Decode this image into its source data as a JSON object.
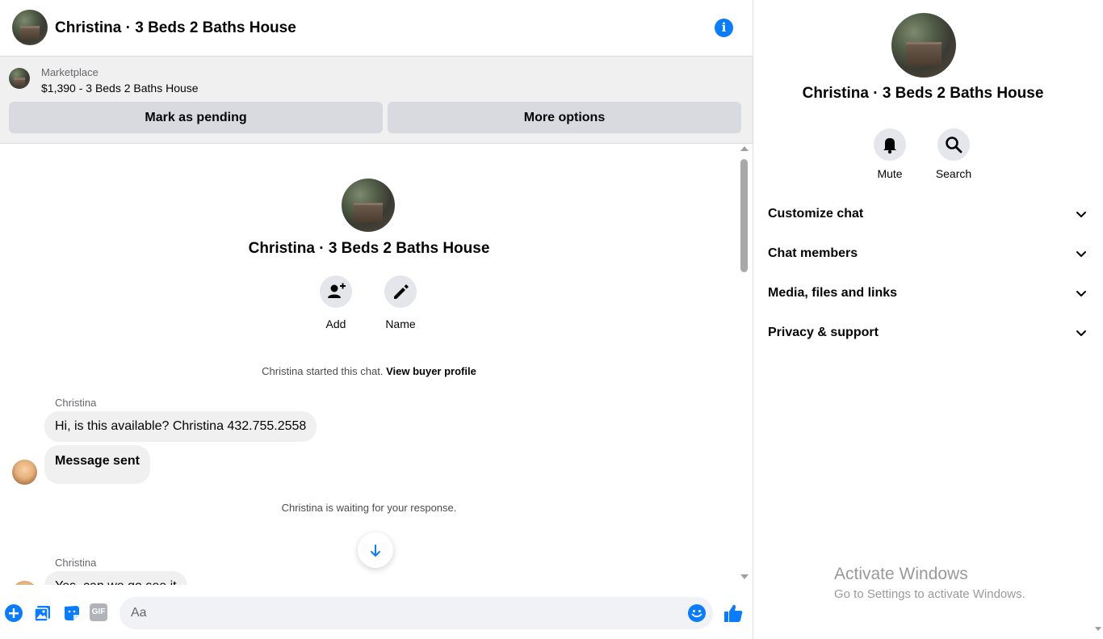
{
  "header": {
    "title": "Christina · 3 Beds 2 Baths House"
  },
  "marketplace": {
    "label": "Marketplace",
    "item": "$1,390 - 3 Beds 2 Baths House",
    "mark_pending_label": "Mark as pending",
    "more_options_label": "More options"
  },
  "conversation": {
    "title": "Christina · 3 Beds 2 Baths House",
    "add_label": "Add",
    "name_label": "Name",
    "started_note": "Christina started this chat.",
    "view_profile_link": "View buyer profile",
    "waiting_note": "Christina is waiting for your response.",
    "messages": [
      {
        "sender": "Christina",
        "text": "Hi, is this available? Christina 432.755.2558"
      },
      {
        "sender": "",
        "text": "Message sent"
      },
      {
        "sender": "Christina",
        "text": "Yes, can we go see it"
      }
    ]
  },
  "composer": {
    "placeholder": "Aa",
    "gif_label": "GIF"
  },
  "info_panel": {
    "title": "Christina · 3 Beds 2 Baths House",
    "mute_label": "Mute",
    "search_label": "Search",
    "sections": [
      {
        "label": "Customize chat"
      },
      {
        "label": "Chat members"
      },
      {
        "label": "Media, files and links"
      },
      {
        "label": "Privacy & support"
      }
    ]
  },
  "watermark": {
    "title": "Activate Windows",
    "subtitle": "Go to Settings to activate Windows."
  },
  "colors": {
    "accent": "#0a7cff",
    "bubble": "#f0f0f0",
    "panel": "#f0f0f0",
    "button": "#d8dadf"
  }
}
